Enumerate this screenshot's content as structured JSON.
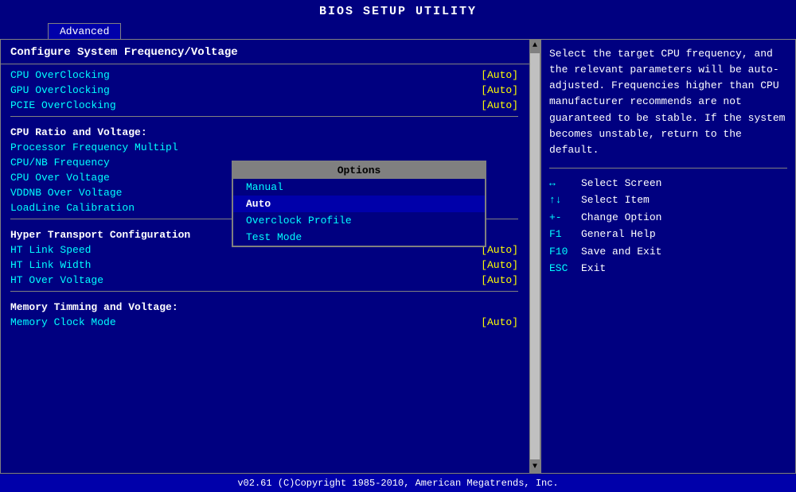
{
  "title": "BIOS SETUP UTILITY",
  "tabs": [
    {
      "label": "Advanced",
      "active": true
    }
  ],
  "left_panel": {
    "section_title": "Configure System Frequency/Voltage",
    "items": [
      {
        "label": "CPU OverClocking",
        "value": "[Auto]"
      },
      {
        "label": "GPU OverClocking",
        "value": "[Auto]"
      },
      {
        "label": "PCIE OverClocking",
        "value": "[Auto]"
      }
    ],
    "cpu_section_header": "CPU Ratio and Voltage:",
    "cpu_items": [
      {
        "label": "Processor Frequency Multipl",
        "value": ""
      },
      {
        "label": "CPU/NB Frequency",
        "value": ""
      },
      {
        "label": "CPU Over Voltage",
        "value": ""
      },
      {
        "label": "VDDNB Over Voltage",
        "value": ""
      },
      {
        "label": "LoadLine Calibration",
        "value": ""
      }
    ],
    "ht_section_header": "Hyper Transport Configuration",
    "ht_items": [
      {
        "label": "HT Link Speed",
        "value": "[Auto]"
      },
      {
        "label": "HT Link Width",
        "value": "[Auto]"
      },
      {
        "label": "HT Over Voltage",
        "value": "[Auto]"
      }
    ],
    "mem_section_header": "Memory Timming and Voltage:",
    "mem_items": [
      {
        "label": "Memory Clock Mode",
        "value": "[Auto]"
      }
    ]
  },
  "dropdown": {
    "title": "Options",
    "items": [
      {
        "label": "Manual",
        "selected": false
      },
      {
        "label": "Auto",
        "selected": true
      },
      {
        "label": "Overclock Profile",
        "selected": false
      },
      {
        "label": "Test Mode",
        "selected": false
      }
    ]
  },
  "right_panel": {
    "help_text": "Select the target CPU frequency, and the relevant parameters will be auto-adjusted. Frequencies higher than CPU manufacturer recommends are not guaranteed to be stable. If the system becomes unstable, return to the default.",
    "keys": [
      {
        "symbol": "↔",
        "desc": "Select Screen"
      },
      {
        "symbol": "↑↓",
        "desc": "Select Item"
      },
      {
        "symbol": "+-",
        "desc": "Change Option"
      },
      {
        "symbol": "F1",
        "desc": "General Help"
      },
      {
        "symbol": "F10",
        "desc": "Save and Exit"
      },
      {
        "symbol": "ESC",
        "desc": "Exit"
      }
    ]
  },
  "footer": "v02.61  (C)Copyright 1985-2010, American Megatrends, Inc."
}
